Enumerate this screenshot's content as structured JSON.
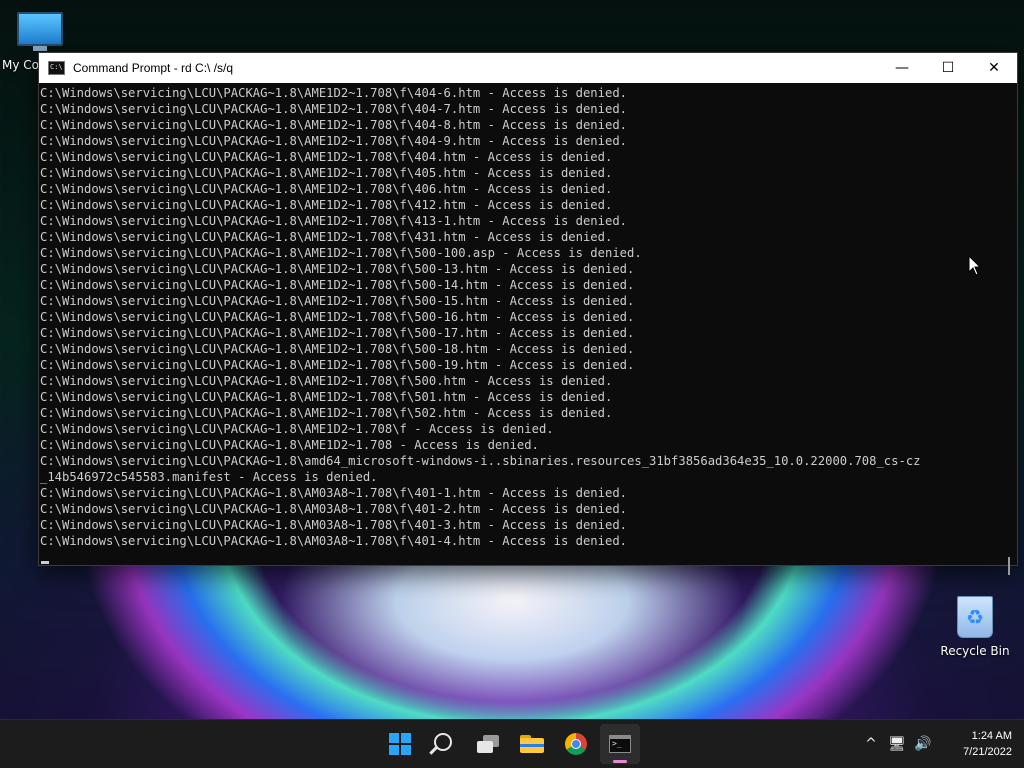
{
  "desktop": {
    "my_computer_label": "My Co",
    "recycle_bin_label": "Recycle Bin"
  },
  "window": {
    "title": "Command Prompt - rd  C:\\ /s/q",
    "controls": {
      "minimize": "—",
      "maximize": "☐",
      "close": "✕"
    },
    "console_lines": [
      "C:\\Windows\\servicing\\LCU\\PACKAG~1.8\\AME1D2~1.708\\f\\404-6.htm - Access is denied.",
      "C:\\Windows\\servicing\\LCU\\PACKAG~1.8\\AME1D2~1.708\\f\\404-7.htm - Access is denied.",
      "C:\\Windows\\servicing\\LCU\\PACKAG~1.8\\AME1D2~1.708\\f\\404-8.htm - Access is denied.",
      "C:\\Windows\\servicing\\LCU\\PACKAG~1.8\\AME1D2~1.708\\f\\404-9.htm - Access is denied.",
      "C:\\Windows\\servicing\\LCU\\PACKAG~1.8\\AME1D2~1.708\\f\\404.htm - Access is denied.",
      "C:\\Windows\\servicing\\LCU\\PACKAG~1.8\\AME1D2~1.708\\f\\405.htm - Access is denied.",
      "C:\\Windows\\servicing\\LCU\\PACKAG~1.8\\AME1D2~1.708\\f\\406.htm - Access is denied.",
      "C:\\Windows\\servicing\\LCU\\PACKAG~1.8\\AME1D2~1.708\\f\\412.htm - Access is denied.",
      "C:\\Windows\\servicing\\LCU\\PACKAG~1.8\\AME1D2~1.708\\f\\413-1.htm - Access is denied.",
      "C:\\Windows\\servicing\\LCU\\PACKAG~1.8\\AME1D2~1.708\\f\\431.htm - Access is denied.",
      "C:\\Windows\\servicing\\LCU\\PACKAG~1.8\\AME1D2~1.708\\f\\500-100.asp - Access is denied.",
      "C:\\Windows\\servicing\\LCU\\PACKAG~1.8\\AME1D2~1.708\\f\\500-13.htm - Access is denied.",
      "C:\\Windows\\servicing\\LCU\\PACKAG~1.8\\AME1D2~1.708\\f\\500-14.htm - Access is denied.",
      "C:\\Windows\\servicing\\LCU\\PACKAG~1.8\\AME1D2~1.708\\f\\500-15.htm - Access is denied.",
      "C:\\Windows\\servicing\\LCU\\PACKAG~1.8\\AME1D2~1.708\\f\\500-16.htm - Access is denied.",
      "C:\\Windows\\servicing\\LCU\\PACKAG~1.8\\AME1D2~1.708\\f\\500-17.htm - Access is denied.",
      "C:\\Windows\\servicing\\LCU\\PACKAG~1.8\\AME1D2~1.708\\f\\500-18.htm - Access is denied.",
      "C:\\Windows\\servicing\\LCU\\PACKAG~1.8\\AME1D2~1.708\\f\\500-19.htm - Access is denied.",
      "C:\\Windows\\servicing\\LCU\\PACKAG~1.8\\AME1D2~1.708\\f\\500.htm - Access is denied.",
      "C:\\Windows\\servicing\\LCU\\PACKAG~1.8\\AME1D2~1.708\\f\\501.htm - Access is denied.",
      "C:\\Windows\\servicing\\LCU\\PACKAG~1.8\\AME1D2~1.708\\f\\502.htm - Access is denied.",
      "C:\\Windows\\servicing\\LCU\\PACKAG~1.8\\AME1D2~1.708\\f - Access is denied.",
      "C:\\Windows\\servicing\\LCU\\PACKAG~1.8\\AME1D2~1.708 - Access is denied.",
      "C:\\Windows\\servicing\\LCU\\PACKAG~1.8\\amd64_microsoft-windows-i..sbinaries.resources_31bf3856ad364e35_10.0.22000.708_cs-cz",
      "_14b546972c545583.manifest - Access is denied.",
      "C:\\Windows\\servicing\\LCU\\PACKAG~1.8\\AM03A8~1.708\\f\\401-1.htm - Access is denied.",
      "C:\\Windows\\servicing\\LCU\\PACKAG~1.8\\AM03A8~1.708\\f\\401-2.htm - Access is denied.",
      "C:\\Windows\\servicing\\LCU\\PACKAG~1.8\\AM03A8~1.708\\f\\401-3.htm - Access is denied.",
      "C:\\Windows\\servicing\\LCU\\PACKAG~1.8\\AM03A8~1.708\\f\\401-4.htm - Access is denied."
    ]
  },
  "taskbar": {
    "apps": [
      {
        "name": "start-button",
        "icon": "windows-logo-icon"
      },
      {
        "name": "search-button",
        "icon": "search-icon"
      },
      {
        "name": "task-view-button",
        "icon": "task-view-icon"
      },
      {
        "name": "file-explorer-button",
        "icon": "folder-icon"
      },
      {
        "name": "chrome-button",
        "icon": "chrome-icon"
      },
      {
        "name": "command-prompt-button",
        "icon": "terminal-icon",
        "active": true
      }
    ],
    "tray": {
      "chevron": "^",
      "network": "🖥",
      "volume": "🔊"
    },
    "clock": {
      "time": "1:24 AM",
      "date": "7/21/2022"
    }
  },
  "colors": {
    "console_bg": "#0c0c0c",
    "console_fg": "#cccccc",
    "taskbar_bg": "#1c1c1c",
    "accent": "#2aa4f4",
    "active_indicator": "#e58bd0"
  }
}
